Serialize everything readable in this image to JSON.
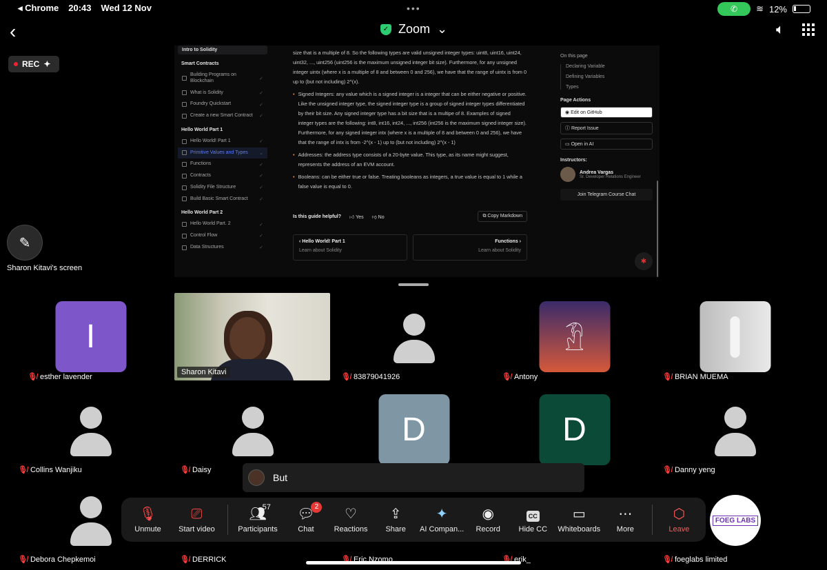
{
  "status": {
    "app": "Chrome",
    "time": "20:43",
    "date": "Wed 12 Nov",
    "battery": "12%"
  },
  "topbar": {
    "title": "Zoom",
    "rec": "REC"
  },
  "shared_screen": {
    "presenter_label": "Sharon Kitavi's screen",
    "sidebar": {
      "course": "Intro to Solidity",
      "sections": [
        {
          "title": "Smart Contracts",
          "items": [
            "Building Programs on Blockchain",
            "What is Solidity",
            "Foundry Quickstart",
            "Create a new Smart Contract"
          ]
        },
        {
          "title": "Hello World Part 1",
          "items": [
            "Hello World! Part 1",
            "Primitive Values and Types",
            "Functions",
            "Contracts",
            "Solidity File Structure",
            "Build Basic Smart Contract"
          ]
        },
        {
          "title": "Hello World Part 2",
          "items": [
            "Hello World Part. 2",
            "Control Flow",
            "Data Structures"
          ]
        }
      ],
      "active_item": "Primitive Values and Types"
    },
    "content": {
      "p1": "size that is a multiple of 8. So the following types are valid unsigned integer types: uint8, uint16, uint24, uint32, ..., uint256 (uint256 is the maximum unsigned integer bit size). Furthermore, for any unsigned integer uintx (where x is a multiple of 8 and between 0 and 256), we have that the range of uintx is from 0 up to (but not including) 2^(x).",
      "b1": "Signed Integers: any value which is a signed integer is a integer that can be either negative or positive. Like the unsigned integer type, the signed integer type is a group of signed integer types differentiated by their bit size. Any signed integer type has a bit size that is a multipe of 8. Examples of signed integer types are the following: int8, int16, int24, ..., int256 (int256 is the maximum signed integer size). Furthermore, for any signed integer intx (where x is a multiple of 8 and between 0 and 256), we have that the range of intx is from -2^(x - 1) up to (but not including) 2^(x - 1)",
      "b2": "Addresses: the address type consists of a 20-byte value. This type, as its name might suggest, represents the address of an EVM account.",
      "b3": "Booleans: can be either true or false. Treating booleans as integers, a true value is equal to 1 while a false value is equal to 0.",
      "helpful": "Is this guide helpful?",
      "yes": "Yes",
      "no": "No",
      "copy": "Copy Markdown",
      "prev_title": "Hello World! Part 1",
      "prev_sub": "Learn about Solidity",
      "next_title": "Functions",
      "next_sub": "Learn about Solidity"
    },
    "right": {
      "on_this_page": "On this page",
      "toc": [
        "Declaring Variable",
        "Defining Variables",
        "Types"
      ],
      "page_actions": "Page Actions",
      "actions": [
        "Edit on GitHub",
        "Report Issue",
        "Open in AI"
      ],
      "instructors": "Instructors:",
      "instructor_name": "Andrea Vargas",
      "instructor_role": "Sr. Developer Relations Engineer",
      "telegram": "Join Telegram Course Chat"
    }
  },
  "participants": [
    {
      "name": "esther lavender",
      "initial": "I",
      "color": "#7d57c9"
    },
    {
      "name": "Sharon Kitavi"
    },
    {
      "name": "83879041926"
    },
    {
      "name": "Antony"
    },
    {
      "name": "BRIAN MUEMA"
    },
    {
      "name": "Collins Wanjiku"
    },
    {
      "name": "Daisy"
    },
    {
      "name": "",
      "initial": "D",
      "color": "#7f97a4"
    },
    {
      "name": "",
      "initial": "D",
      "color": "#0b4a37"
    },
    {
      "name": "Danny yeng"
    },
    {
      "name": "Debora Chepkemoi"
    },
    {
      "name": "DERRICK"
    },
    {
      "name": "Eric Nzomo"
    },
    {
      "name": "erik_"
    },
    {
      "name": "foeglabs limited"
    }
  ],
  "chat_popup": {
    "text": "But"
  },
  "toolbar": {
    "unmute": "Unmute",
    "start_video": "Start video",
    "participants": "Participants",
    "participants_count": "57",
    "chat": "Chat",
    "chat_badge": "2",
    "reactions": "Reactions",
    "share": "Share",
    "ai": "AI Compan...",
    "record": "Record",
    "hide_cc": "Hide CC",
    "cc_icon": "CC",
    "whiteboards": "Whiteboards",
    "more": "More",
    "leave": "Leave"
  },
  "logo": "FOEG LABS"
}
